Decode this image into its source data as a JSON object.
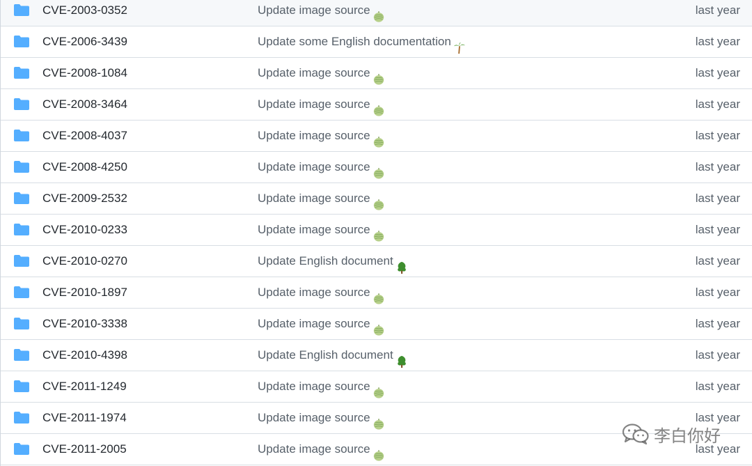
{
  "rows": [
    {
      "name": "CVE-2003-0352",
      "message": "Update image source",
      "emoji": "melon-icon",
      "age": "last year"
    },
    {
      "name": "CVE-2006-3439",
      "message": "Update some English documentation",
      "emoji": "palm-tree-icon",
      "age": "last year"
    },
    {
      "name": "CVE-2008-1084",
      "message": "Update image source",
      "emoji": "melon-icon",
      "age": "last year"
    },
    {
      "name": "CVE-2008-3464",
      "message": "Update image source",
      "emoji": "melon-icon",
      "age": "last year"
    },
    {
      "name": "CVE-2008-4037",
      "message": "Update image source",
      "emoji": "melon-icon",
      "age": "last year"
    },
    {
      "name": "CVE-2008-4250",
      "message": "Update image source",
      "emoji": "melon-icon",
      "age": "last year"
    },
    {
      "name": "CVE-2009-2532",
      "message": "Update image source",
      "emoji": "melon-icon",
      "age": "last year"
    },
    {
      "name": "CVE-2010-0233",
      "message": "Update image source",
      "emoji": "melon-icon",
      "age": "last year"
    },
    {
      "name": "CVE-2010-0270",
      "message": "Update English document",
      "emoji": "tree-icon",
      "age": "last year"
    },
    {
      "name": "CVE-2010-1897",
      "message": "Update image source",
      "emoji": "melon-icon",
      "age": "last year"
    },
    {
      "name": "CVE-2010-3338",
      "message": "Update image source",
      "emoji": "melon-icon",
      "age": "last year"
    },
    {
      "name": "CVE-2010-4398",
      "message": "Update English document",
      "emoji": "tree-icon",
      "age": "last year"
    },
    {
      "name": "CVE-2011-1249",
      "message": "Update image source",
      "emoji": "melon-icon",
      "age": "last year"
    },
    {
      "name": "CVE-2011-1974",
      "message": "Update image source",
      "emoji": "melon-icon",
      "age": "last year"
    },
    {
      "name": "CVE-2011-2005",
      "message": "Update image source",
      "emoji": "melon-icon",
      "age": "last year"
    }
  ],
  "watermark": {
    "text": "李白你好",
    "icon": "wechat-icon"
  },
  "colors": {
    "folder": "#54aeff",
    "name_text": "#24292f",
    "muted_text": "#57606a",
    "border": "#d8dee4"
  }
}
